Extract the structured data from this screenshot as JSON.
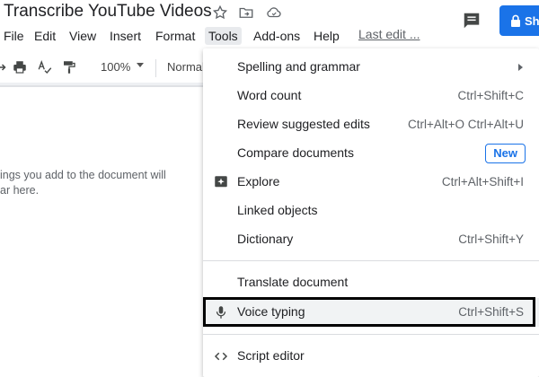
{
  "doc": {
    "title": "Transcribe YouTube Videos",
    "last_edit": "Last edit ..."
  },
  "share": {
    "label": "Sh"
  },
  "menus": [
    "File",
    "Edit",
    "View",
    "Insert",
    "Format",
    "Tools",
    "Add-ons",
    "Help"
  ],
  "active_menu": "Tools",
  "toolbar": {
    "zoom": "100%",
    "style": "Normal"
  },
  "outline": {
    "line1": "ings you add to the document will",
    "line2": "ar here."
  },
  "tools_menu": {
    "items": [
      {
        "label": "Spelling and grammar",
        "shortcut": "",
        "icon": "",
        "submenu": true
      },
      {
        "label": "Word count",
        "shortcut": "Ctrl+Shift+C",
        "icon": ""
      },
      {
        "label": "Review suggested edits",
        "shortcut": "Ctrl+Alt+O Ctrl+Alt+U",
        "icon": ""
      },
      {
        "label": "Compare documents",
        "shortcut": "",
        "badge": "New",
        "icon": ""
      },
      {
        "label": "Explore",
        "shortcut": "Ctrl+Alt+Shift+I",
        "icon": "explore-icon"
      },
      {
        "label": "Linked objects",
        "shortcut": "",
        "icon": ""
      },
      {
        "label": "Dictionary",
        "shortcut": "Ctrl+Shift+Y",
        "icon": ""
      },
      {
        "label": "Translate document",
        "shortcut": "",
        "icon": ""
      },
      {
        "label": "Voice typing",
        "shortcut": "Ctrl+Shift+S",
        "icon": "microphone-icon",
        "highlighted": true
      },
      {
        "label": "Script editor",
        "shortcut": "",
        "icon": "code-icon"
      }
    ]
  },
  "colors": {
    "accent": "#1a73e8",
    "highlight_row": "#f1f3f4",
    "focus_outline": "#000000"
  }
}
